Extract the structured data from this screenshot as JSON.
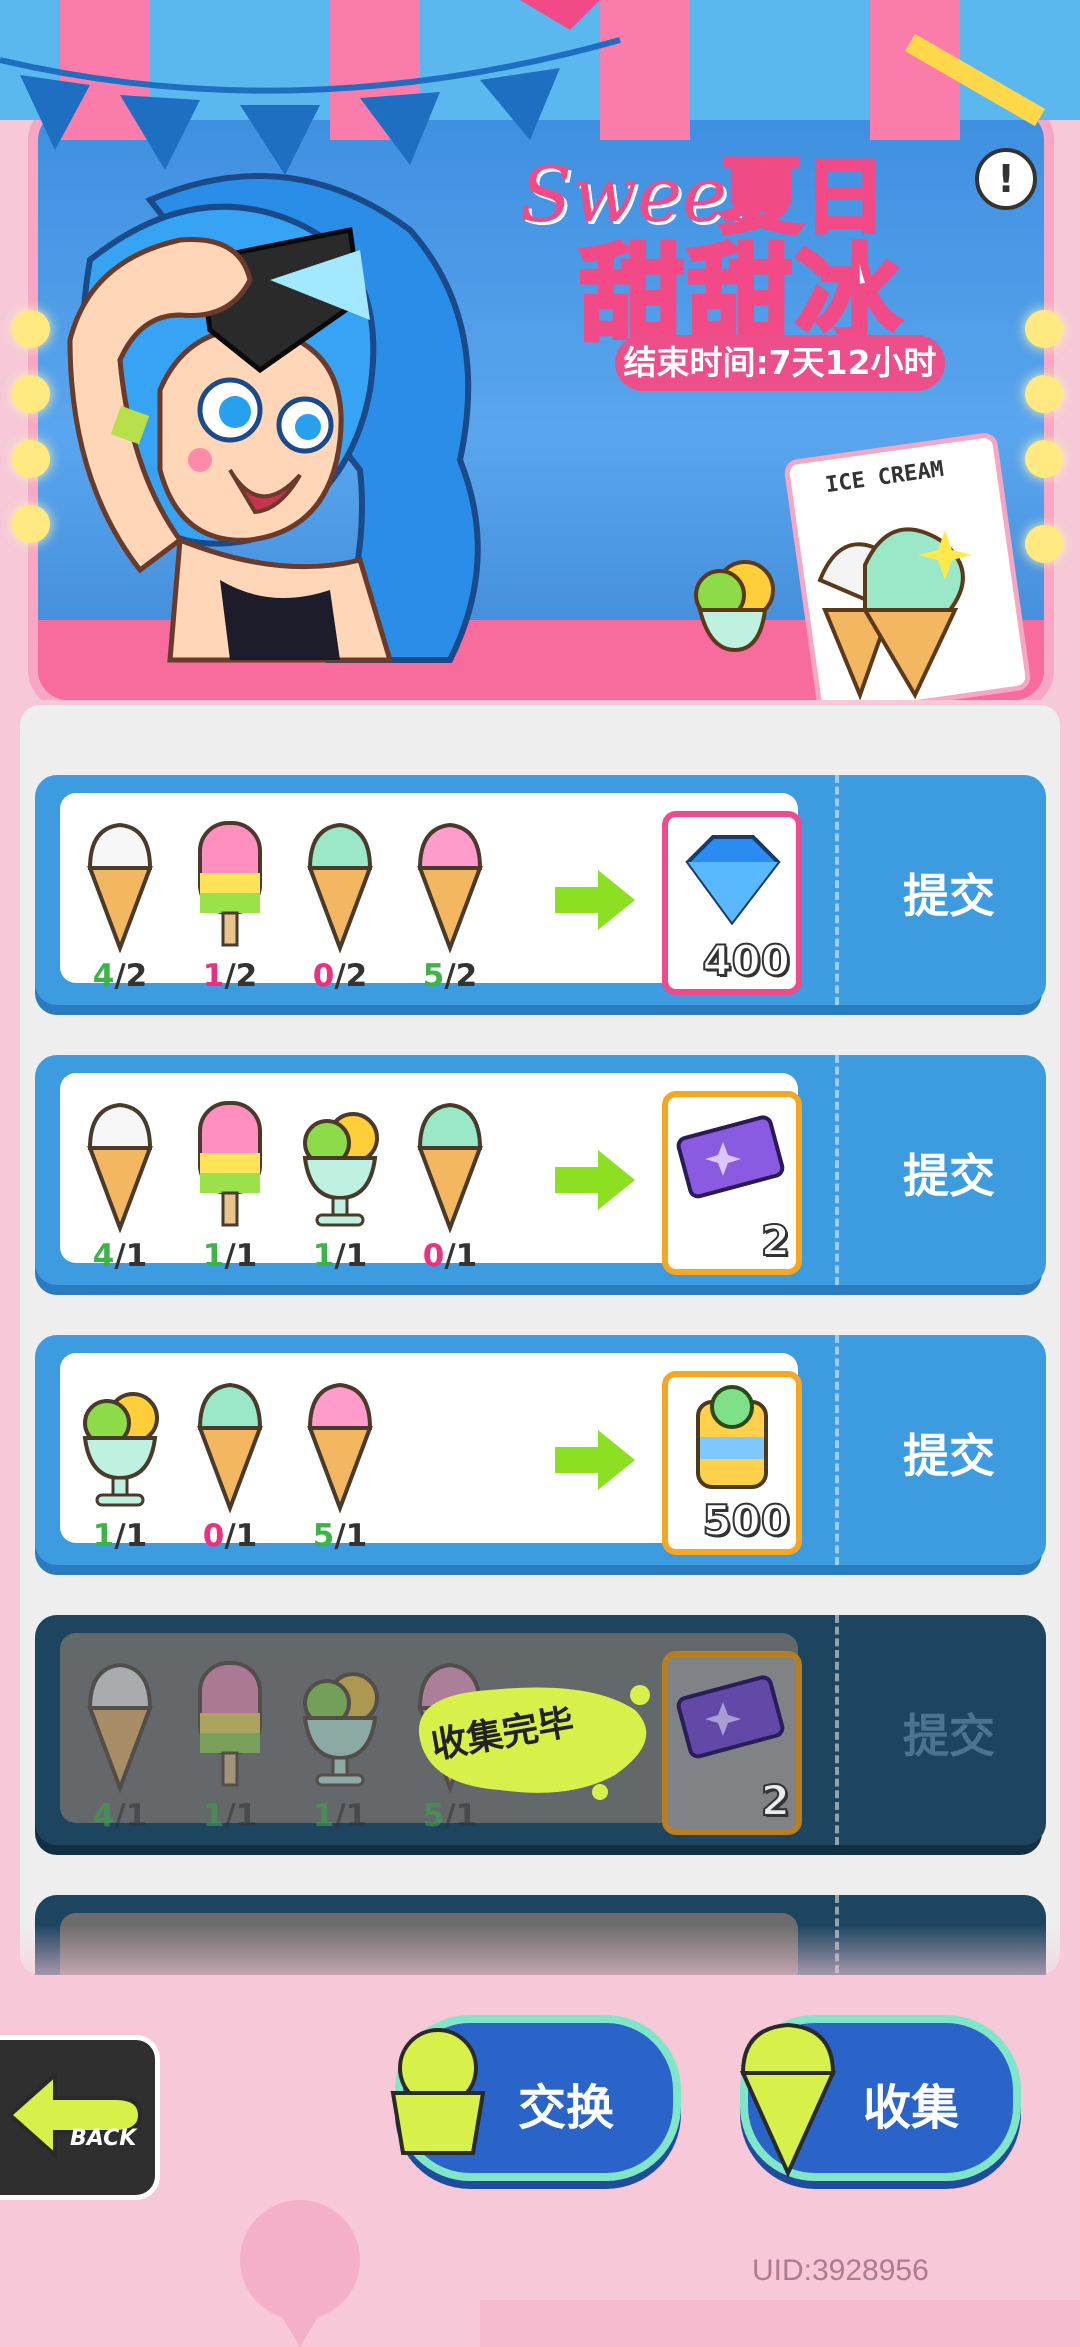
{
  "banner": {
    "title_sweet": "Sweet",
    "title_summer": "夏日",
    "title_main": "甜甜冰",
    "end_time": "结束时间:7天12小时",
    "info_icon": "!",
    "menu_card_text": "ICE CREAM"
  },
  "recipes": [
    {
      "items": [
        {
          "icon": "vanilla-cone-icon",
          "have": "4",
          "need": "/2",
          "color": "green"
        },
        {
          "icon": "popsicle-icon",
          "have": "1",
          "need": "/2",
          "color": "pink"
        },
        {
          "icon": "mint-cone-icon",
          "have": "0",
          "need": "/2",
          "color": "pink"
        },
        {
          "icon": "strawberry-cone-icon",
          "have": "5",
          "need": "/2",
          "color": "green"
        }
      ],
      "reward": {
        "icon": "diamond-icon",
        "qty": "400"
      },
      "submit": "提交",
      "state": "active"
    },
    {
      "items": [
        {
          "icon": "vanilla-cone-icon",
          "have": "4",
          "need": "/1",
          "color": "green"
        },
        {
          "icon": "popsicle-icon",
          "have": "1",
          "need": "/1",
          "color": "green"
        },
        {
          "icon": "sundae-icon",
          "have": "1",
          "need": "/1",
          "color": "green"
        },
        {
          "icon": "mint-cone-icon",
          "have": "0",
          "need": "/1",
          "color": "pink"
        }
      ],
      "reward": {
        "icon": "ticket-icon",
        "qty": "2"
      },
      "submit": "提交",
      "state": "active"
    },
    {
      "items": [
        {
          "icon": "sundae-icon",
          "have": "1",
          "need": "/1",
          "color": "green"
        },
        {
          "icon": "mint-cone-icon",
          "have": "0",
          "need": "/1",
          "color": "pink"
        },
        {
          "icon": "strawberry-cone-icon",
          "have": "5",
          "need": "/1",
          "color": "green"
        }
      ],
      "reward": {
        "icon": "coin-jar-icon",
        "qty": "500"
      },
      "submit": "提交",
      "state": "active"
    },
    {
      "items": [
        {
          "icon": "vanilla-cone-icon",
          "have": "4",
          "need": "/1",
          "color": "green"
        },
        {
          "icon": "popsicle-icon",
          "have": "1",
          "need": "/1",
          "color": "green"
        },
        {
          "icon": "sundae-icon",
          "have": "1",
          "need": "/1",
          "color": "green"
        },
        {
          "icon": "strawberry-cone-icon",
          "have": "5",
          "need": "/1",
          "color": "green"
        }
      ],
      "reward": {
        "icon": "ticket-icon",
        "qty": "2"
      },
      "submit": "提交",
      "state": "done",
      "done_label": "收集完毕"
    }
  ],
  "bottom": {
    "back_label": "BACK",
    "exchange_label": "交换",
    "collect_label": "收集",
    "uid": "UID:3928956"
  },
  "colors": {
    "accent_pink": "#f24a86",
    "panel_blue": "#3d9be0",
    "done_panel": "#1d4560",
    "count_green": "#3cb44a",
    "count_pink": "#ec2f7f"
  }
}
